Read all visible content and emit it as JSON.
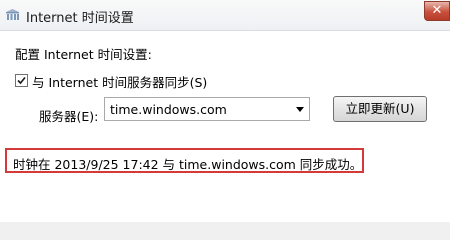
{
  "window": {
    "title": "Internet 时间设置",
    "close_glyph": "✕",
    "icon": "internet-time-icon"
  },
  "main": {
    "config_label": "配置 Internet 时间设置:",
    "sync_checkbox": {
      "label": "与 Internet 时间服务器同步(S)",
      "checked": true
    },
    "server_label": "服务器(E):",
    "server_value": "time.windows.com",
    "update_button": "立即更新(U)",
    "status_message": "时钟在 2013/9/25 17:42 与 time.windows.com 同步成功。"
  },
  "colors": {
    "highlight_border": "#d43a3a",
    "close_button": "#c8503c"
  }
}
